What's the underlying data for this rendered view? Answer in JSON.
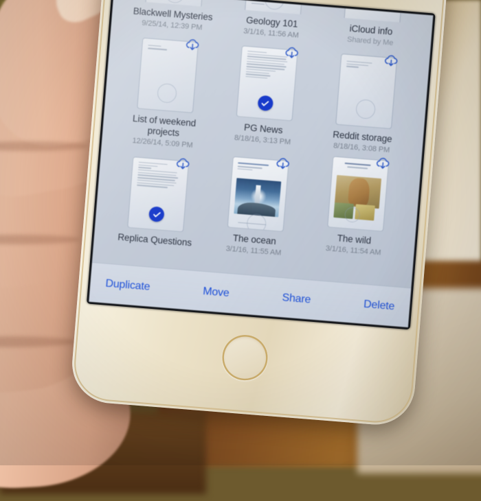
{
  "device": {
    "type": "iphone",
    "finish": "gold",
    "home_button": "home-button"
  },
  "app": {
    "name": "iCloud Drive document browser",
    "selection_mode": true
  },
  "documents": [
    {
      "title": "Blackwell Mysteries",
      "date": "9/25/14, 12:39 PM",
      "thumb": "text-document",
      "cropped": true,
      "cloud_icon": false,
      "selected": false
    },
    {
      "title": "Geology 101",
      "date": "3/1/16, 11:56 AM",
      "thumb": "text-document",
      "cropped": true,
      "cloud_icon": false,
      "selected": false
    },
    {
      "title": "iCloud info",
      "date": "Shared by Me",
      "thumb": "text-document",
      "cropped": true,
      "cloud_icon": false,
      "selected": true
    },
    {
      "title": "List of weekend projects",
      "date": "12/26/14, 5:09 PM",
      "thumb": "blank-document",
      "cropped": false,
      "cloud_icon": true,
      "selected": false
    },
    {
      "title": "PG News",
      "date": "8/18/16, 3:13 PM",
      "thumb": "text-document",
      "cropped": false,
      "cloud_icon": true,
      "selected": true
    },
    {
      "title": "Reddit storage",
      "date": "8/18/16, 3:08 PM",
      "thumb": "blank-document",
      "cropped": false,
      "cloud_icon": true,
      "selected": false
    },
    {
      "title": "Replica Questions",
      "date": "",
      "thumb": "text-document",
      "cropped": false,
      "cloud_icon": true,
      "selected": true
    },
    {
      "title": "The ocean",
      "date": "3/1/16, 11:55 AM",
      "thumb": "ocean-photo-document",
      "thumb_heading": "Reflections by rock is",
      "cropped": false,
      "cloud_icon": true,
      "selected": false
    },
    {
      "title": "The wild",
      "date": "3/1/16, 11:54 AM",
      "thumb": "wildlife-photo-document",
      "thumb_heading": "African Wildlife",
      "cropped": false,
      "cloud_icon": true,
      "selected": false
    }
  ],
  "toolbar": {
    "duplicate_label": "Duplicate",
    "move_label": "Move",
    "share_label": "Share",
    "delete_label": "Delete"
  },
  "colors": {
    "accent_blue": "#1b4ed8",
    "selection_blue": "#1437c9",
    "screen_background": "#c5ccd8",
    "title_text": "#2b3240",
    "date_text": "#79828f"
  }
}
